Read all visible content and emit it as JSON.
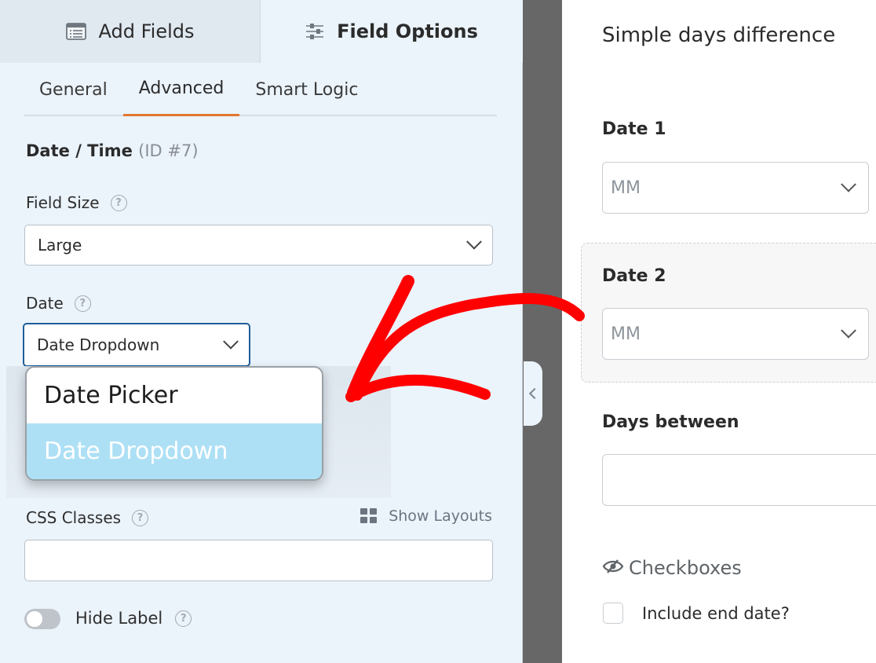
{
  "top_tabs": {
    "add_fields": {
      "label": "Add Fields",
      "icon": "list-icon"
    },
    "field_options": {
      "label": "Field Options",
      "icon": "sliders-icon"
    }
  },
  "sub_tabs": [
    {
      "label": "General"
    },
    {
      "label": "Advanced",
      "active": true
    },
    {
      "label": "Smart Logic"
    }
  ],
  "section": {
    "title": "Date / Time",
    "id_text": "(ID #7)"
  },
  "field_size": {
    "label": "Field Size",
    "value": "Large"
  },
  "date": {
    "label": "Date",
    "value": "Date Dropdown",
    "options": [
      {
        "label": "Date Picker",
        "selected": false
      },
      {
        "label": "Date Dropdown",
        "selected": true
      }
    ]
  },
  "css_classes": {
    "label": "CSS Classes",
    "value": "",
    "show_layouts": "Show Layouts"
  },
  "hide_label": {
    "label": "Hide Label",
    "on": false
  },
  "preview": {
    "title": "Simple days difference",
    "fields": {
      "date1": {
        "label": "Date 1",
        "placeholder": "MM"
      },
      "date2": {
        "label": "Date 2",
        "placeholder": "MM"
      },
      "days_between": {
        "label": "Days between",
        "value": ""
      },
      "checkboxes": {
        "label": "Checkboxes",
        "icon": "eye-slash-icon"
      },
      "include_end_date": {
        "label": "Include end date?",
        "checked": false
      }
    }
  },
  "colors": {
    "accent_tab": "#e27730",
    "focus_border": "#1f5e99",
    "selected_option": "#ade0f5",
    "annotation_arrow": "#ff0000"
  },
  "help_glyph": "?"
}
